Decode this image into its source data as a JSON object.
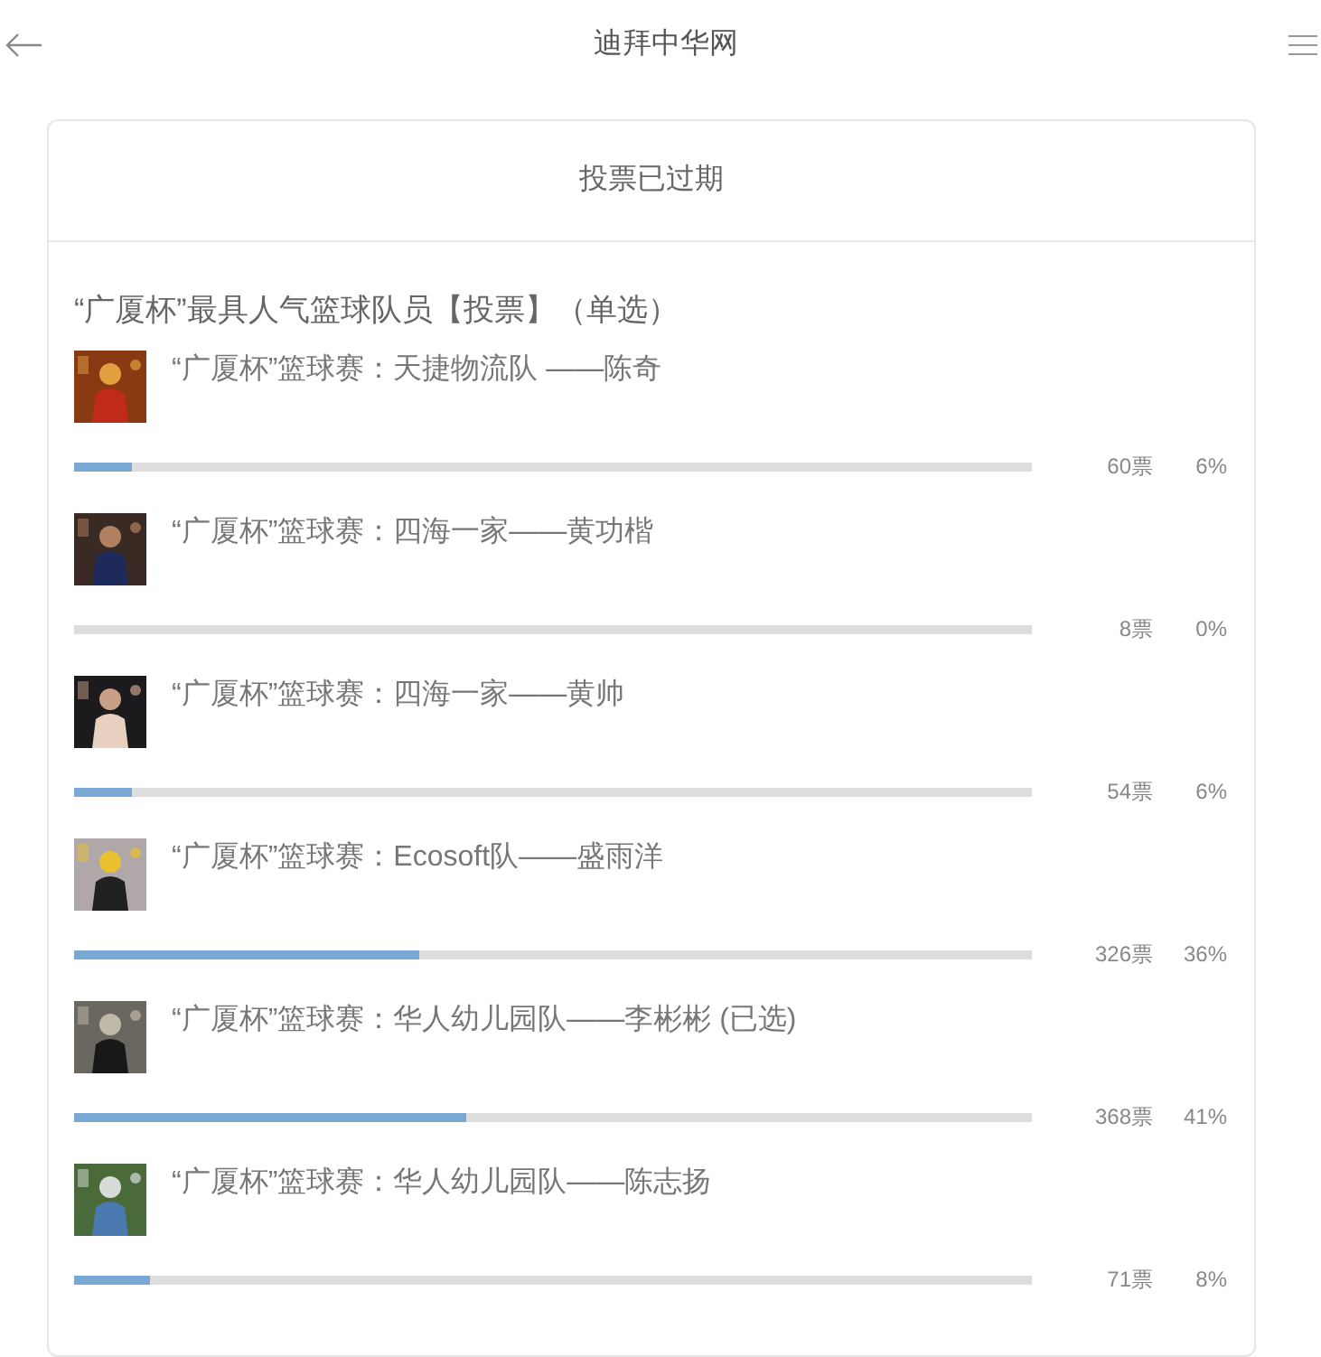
{
  "header": {
    "title": "迪拜中华网"
  },
  "card": {
    "status": "投票已过期",
    "question": "“广厦杯”最具人气篮球队员【投票】（单选）",
    "options": [
      {
        "label": "“广厦杯”篮球赛：天捷物流队 ——陈奇",
        "votes": "60票",
        "percent": "6%",
        "level": 0.06
      },
      {
        "label": "“广厦杯”篮球赛：四海一家——黄功楷",
        "votes": "8票",
        "percent": "0%"
      },
      {
        "label": "“广厦杯”篮球赛：四海一家——黄帅",
        "votes": "54票",
        "percent": "6%",
        "level": 0.06
      },
      {
        "label": "“广厦杯”篮球赛：Ecosoft队——盛雨洋",
        "votes": "326票",
        "percent": "36%",
        "level": 0.36
      },
      {
        "label": "“广厦杯”篮球赛：华人幼儿园队——李彬彬 (已选)",
        "votes": "368票",
        "percent": "41%",
        "level": 0.41
      },
      {
        "label": "“广厦杯”篮球赛：华人幼儿园队——陈志扬",
        "votes": "71票",
        "percent": "8%",
        "level": 0.08
      }
    ]
  }
}
